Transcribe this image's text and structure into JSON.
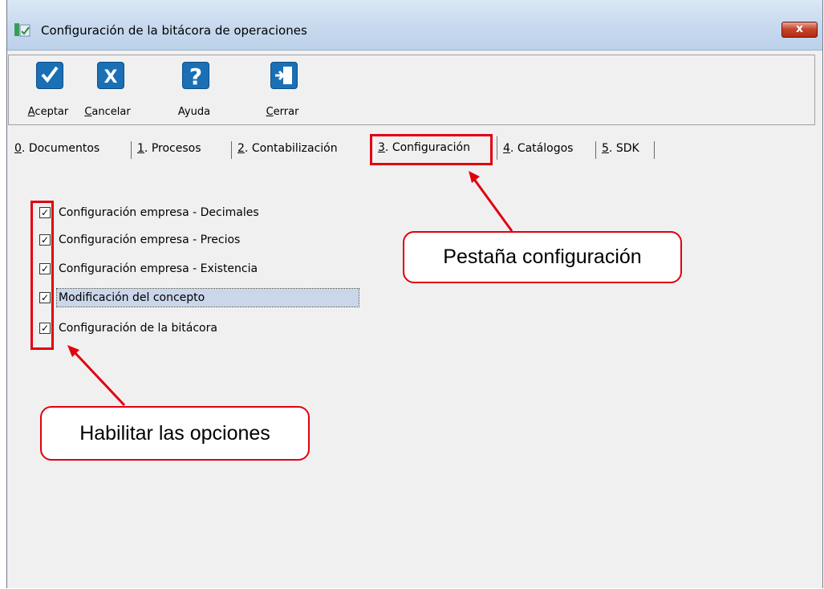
{
  "window": {
    "title": "Configuración de la bitácora de operaciones",
    "close_label": "x"
  },
  "toolbar": {
    "buttons": [
      {
        "label": "Aceptar",
        "mnemonic": "A",
        "rest": "ceptar",
        "icon": "checkmark-icon"
      },
      {
        "label": "Cancelar",
        "mnemonic": "C",
        "rest": "ancelar",
        "icon": "x-icon"
      },
      {
        "label": "Ayuda",
        "mnemonic": "",
        "rest": "Ayuda",
        "icon": "question-icon"
      },
      {
        "label": "Cerrar",
        "mnemonic": "C",
        "rest": "errar",
        "icon": "exit-door-icon"
      }
    ]
  },
  "tabs": [
    {
      "num": "0",
      "text": ". Documentos",
      "active": false
    },
    {
      "num": "1",
      "text": ". Procesos",
      "active": false
    },
    {
      "num": "2",
      "text": ". Contabilización",
      "active": false
    },
    {
      "num": "3",
      "text": ". Configuración",
      "active": true
    },
    {
      "num": "4",
      "text": ". Catálogos",
      "active": false
    },
    {
      "num": "5",
      "text": ". SDK",
      "active": false
    }
  ],
  "options": [
    {
      "label": "Configuración empresa - Decimales",
      "checked": true,
      "selected": false
    },
    {
      "label": "Configuración empresa - Precios",
      "checked": true,
      "selected": false
    },
    {
      "label": "Configuración empresa - Existencia",
      "checked": true,
      "selected": false
    },
    {
      "label": "Modificación del concepto",
      "checked": true,
      "selected": true
    },
    {
      "label": "Configuración de la bitácora",
      "checked": true,
      "selected": false
    }
  ],
  "annotations": {
    "tab_callout": "Pestaña configuración",
    "options_callout": "Habilitar las opciones"
  },
  "colors": {
    "highlight": "#e0000f",
    "toolbar_icon": "#1a6fb5",
    "selection": "#cad6ea"
  }
}
